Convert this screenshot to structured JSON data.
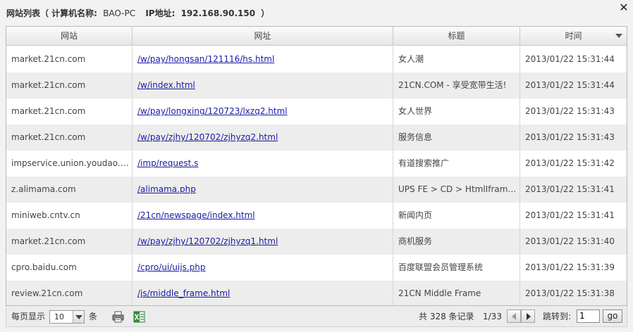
{
  "dialog": {
    "title": "网站列表（ 计算机名称:",
    "computer_name": "BAO-PC",
    "ip_label": "IP地址:",
    "ip_value": "192.168.90.150",
    "title_close": "）",
    "close_symbol": "✕"
  },
  "table": {
    "columns": [
      "网站",
      "网址",
      "标题",
      "时间"
    ],
    "rows": [
      {
        "site": "market.21cn.com",
        "url": "/w/pay/hongsan/121116/hs.html",
        "title": "女人潮",
        "time": "2013/01/22 15:31:44"
      },
      {
        "site": "market.21cn.com",
        "url": "/w/index.html",
        "title": "21CN.COM - 享受宽带生活!",
        "time": "2013/01/22 15:31:44"
      },
      {
        "site": "market.21cn.com",
        "url": "/w/pay/longxing/120723/lxzq2.html",
        "title": "女人世界",
        "time": "2013/01/22 15:31:43"
      },
      {
        "site": "market.21cn.com",
        "url": "/w/pay/zjhy/120702/zjhyzq2.html",
        "title": "服务信息",
        "time": "2013/01/22 15:31:43"
      },
      {
        "site": "impservice.union.youdao.com",
        "url": "/imp/request.s",
        "title": "有道搜索推广",
        "time": "2013/01/22 15:31:42"
      },
      {
        "site": "z.alimama.com",
        "url": "/alimama.php",
        "title": "UPS FE > CD > HtmlIframeVi...",
        "time": "2013/01/22 15:31:41"
      },
      {
        "site": "miniweb.cntv.cn",
        "url": "/21cn/newspage/index.html",
        "title": "新闻内页",
        "time": "2013/01/22 15:31:41"
      },
      {
        "site": "market.21cn.com",
        "url": "/w/pay/zjhy/120702/zjhyzq1.html",
        "title": "商机服务",
        "time": "2013/01/22 15:31:40"
      },
      {
        "site": "cpro.baidu.com",
        "url": "/cpro/ui/uijs.php",
        "title": "百度联盟会员管理系统",
        "time": "2013/01/22 15:31:39"
      },
      {
        "site": "review.21cn.com",
        "url": "/js/middle_frame.html",
        "title": "21CN Middle Frame",
        "time": "2013/01/22 15:31:38"
      }
    ]
  },
  "footer": {
    "per_page_label": "每页显示",
    "per_page_value": "10",
    "per_page_unit": "条",
    "print_icon": "printer-icon",
    "excel_icon": "excel-export-icon",
    "total_text": "共 328 条记录",
    "page_info": "1/33",
    "goto_label": "跳转到:",
    "goto_value": "1",
    "go_label": "go"
  }
}
